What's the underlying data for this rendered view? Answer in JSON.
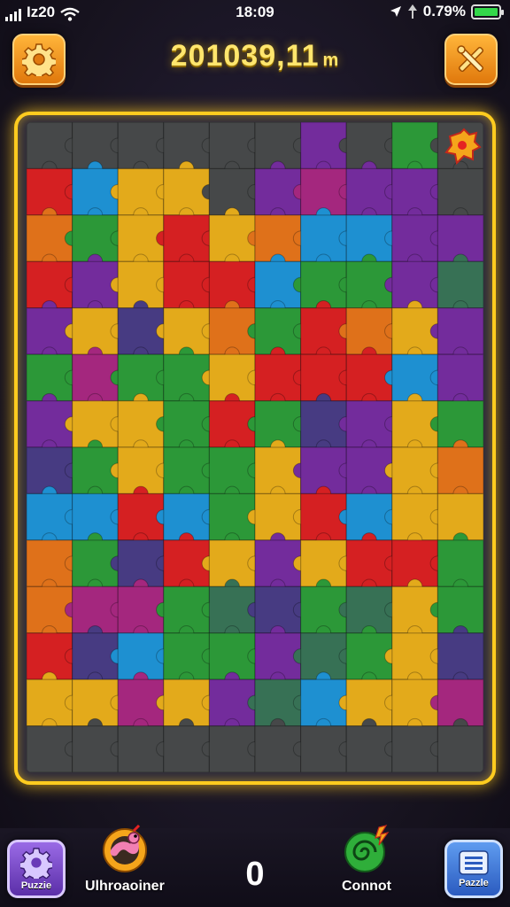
{
  "status_bar": {
    "carrier": "Iz20",
    "time": "18:09",
    "battery_text": "0.79%",
    "battery_level": 1.0
  },
  "header": {
    "title": "201039,11",
    "title_unit": "m",
    "left_button_icon": "gear-icon",
    "right_button_icon": "tools-icon"
  },
  "board": {
    "columns": 10,
    "rows": 14,
    "colors": {
      "R": "#e52222",
      "O": "#f07a1a",
      "Y": "#f5b81b",
      "G": "#2ea43a",
      "B": "#1f9ce0",
      "P": "#7b2fa6",
      "M": "#b02a86",
      "D": "#4b3f8a",
      "T": "#3a7a5a",
      "S": "#4a4e4c"
    },
    "grid": [
      "SSSSSSPSGS",
      "RBYYSPMPPS",
      "OGYRYOBBPP",
      "RPYRRBGGPT",
      "PYDYOGROYP",
      "GMGGYRRRBP",
      "PYYGRGDPYG",
      "DGYGGYPPYO",
      "BBRBGYRBYY",
      "OGDRYPYRRG",
      "OMMGTDGTYG",
      "RDBGGPTGYD",
      "YYMYPTBYYM",
      "SSSSSSSSSS"
    ]
  },
  "bottom_bar": {
    "left_button_label": "Puzzie",
    "left_button_icon": "gear-icon",
    "item_left_label": "Ulhroaoiner",
    "item_left_icon": "worm-bomb-icon",
    "score": "0",
    "item_right_label": "Connot",
    "item_right_icon": "green-swirl-icon",
    "right_button_label": "Pazzle",
    "right_button_icon": "menu-icon"
  }
}
